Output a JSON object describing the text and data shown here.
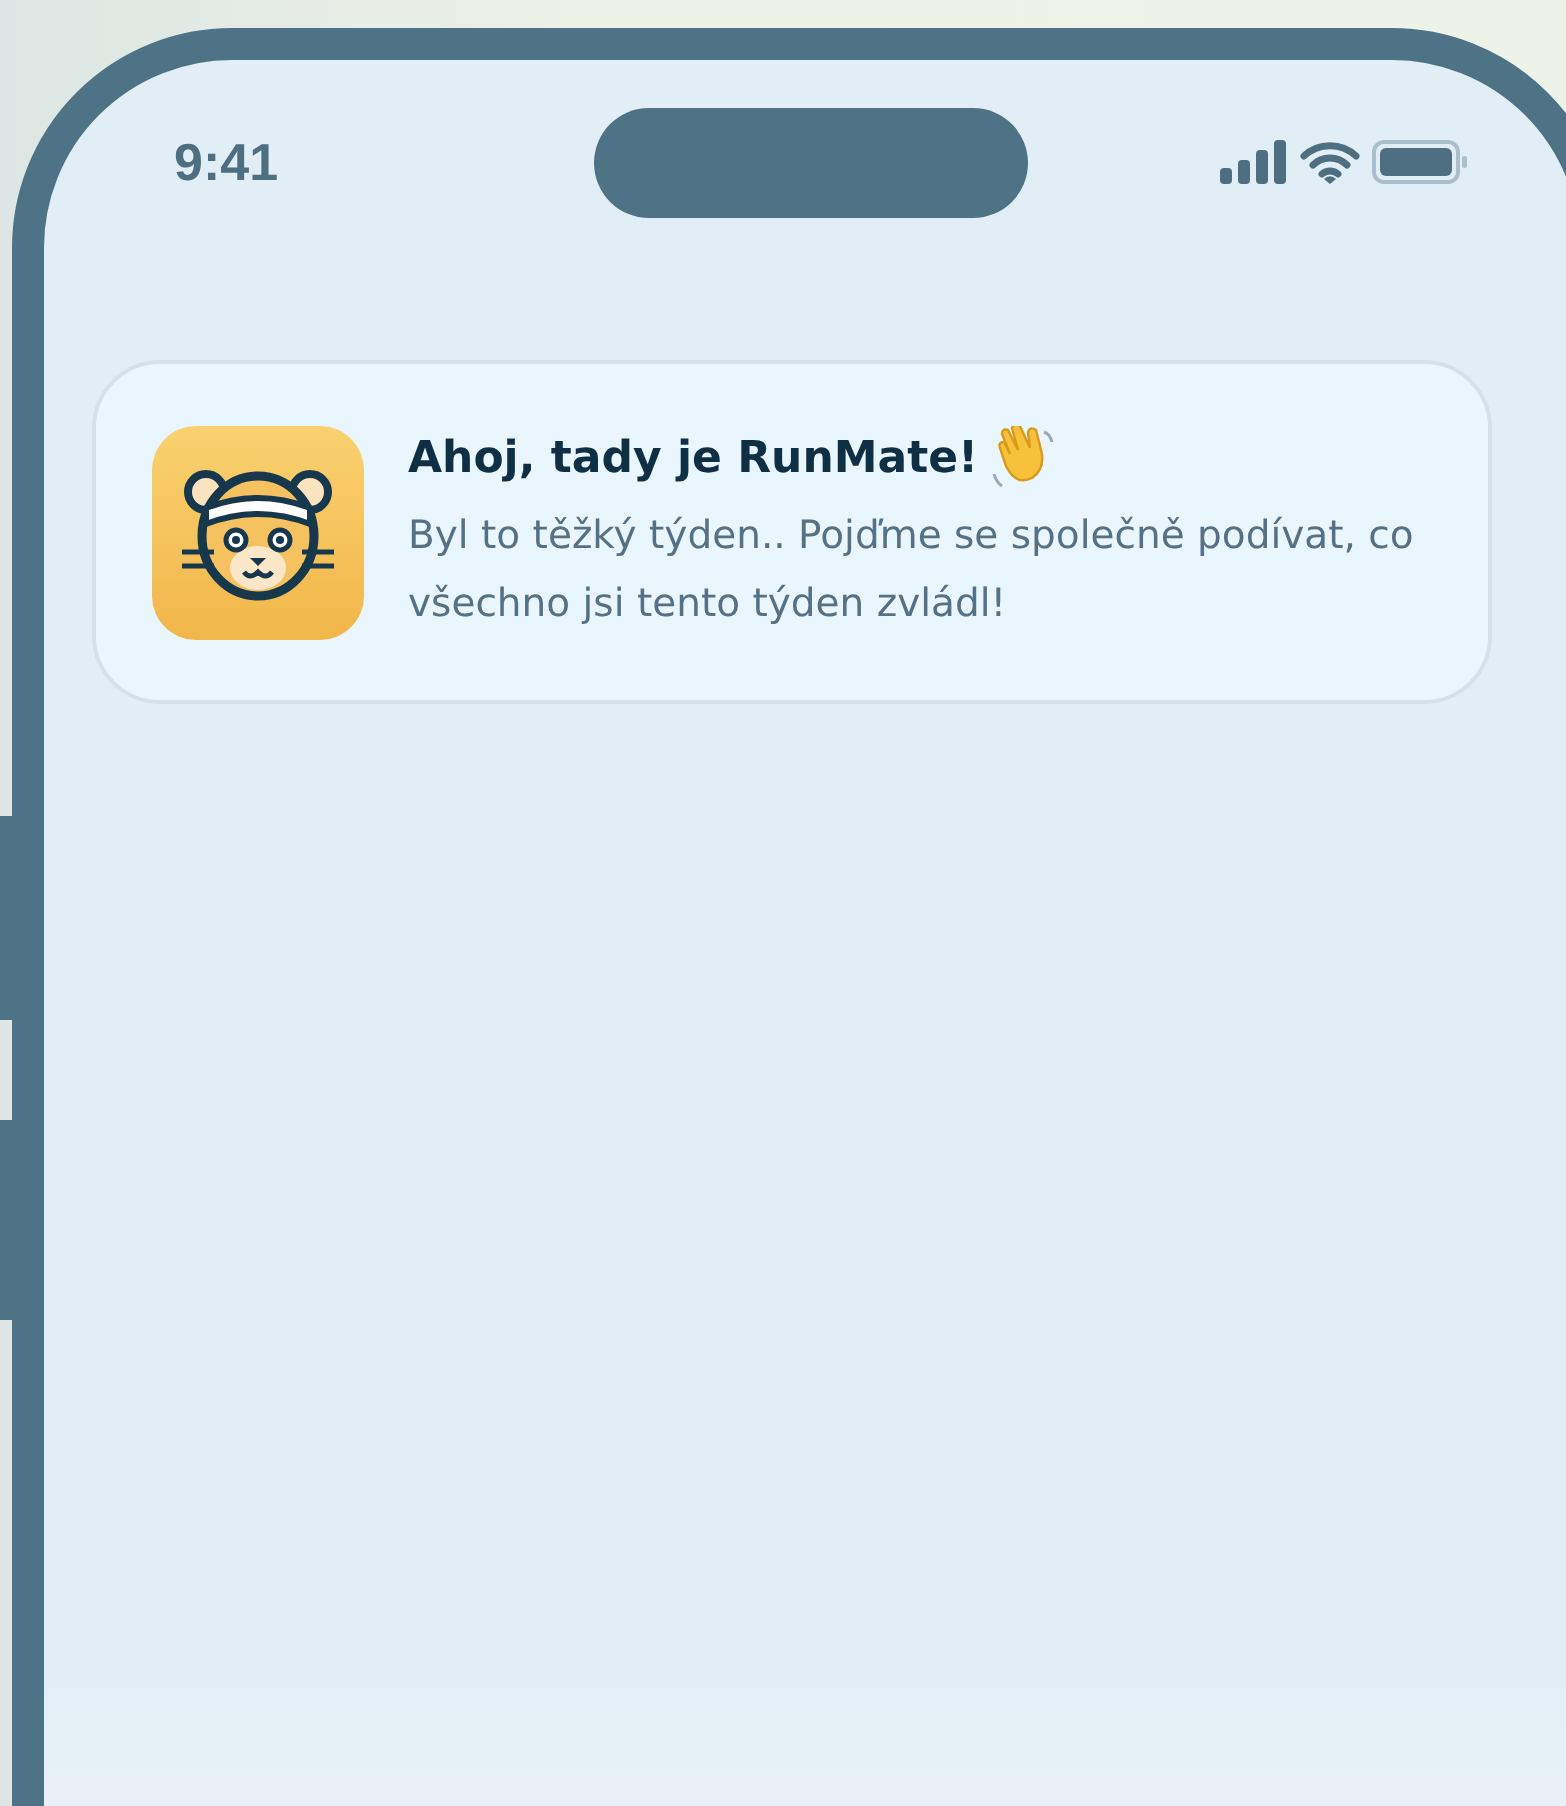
{
  "status_bar": {
    "time": "9:41"
  },
  "notification": {
    "title": "Ahoj, tady je RunMate!",
    "body": "Byl to těžký týden.. Pojďme se společně podívat, co všechno jsi tento týden zvládl!"
  }
}
